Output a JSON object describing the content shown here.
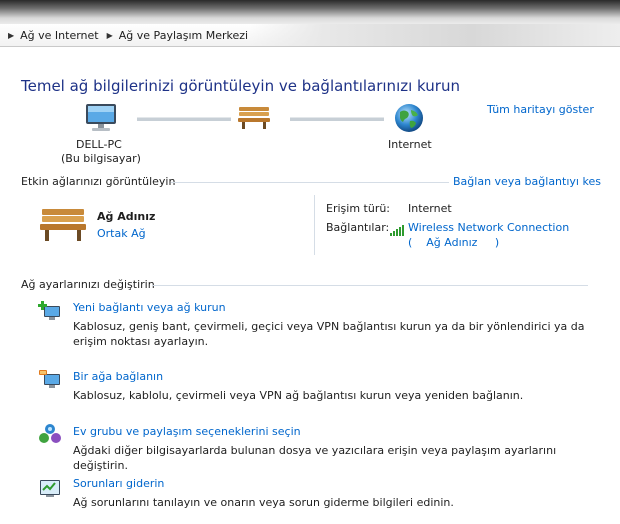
{
  "breadcrumb": {
    "items": [
      "Ağ ve Internet",
      "Ağ ve Paylaşım Merkezi"
    ]
  },
  "page_title": "Temel ağ bilgilerinizi görüntüleyin ve bağlantılarınızı kurun",
  "network_map": {
    "show_full_map_link": "Tüm haritayı göster",
    "computer_name": "DELL-PC",
    "computer_sub": "(Bu bilgisayar)",
    "internet_label": "Internet"
  },
  "active_networks": {
    "heading": "Etkin ağlarınızı görüntüleyin",
    "connect_link": "Bağlan veya bağlantıyı kes",
    "network_name": "Ağ Adınız",
    "network_type": "Ortak Ağ",
    "access_type_label": "Erişim türü:",
    "access_type_value": "Internet",
    "connections_label": "Bağlantılar:",
    "connection_name": "Wireless Network Connection",
    "connection_sub": "(    Ağ Adınız     )"
  },
  "settings": {
    "heading": "Ağ ayarlarınızı değiştirin",
    "tasks": [
      {
        "title": "Yeni bağlantı veya ağ kurun",
        "desc": "Kablosuz, geniş bant, çevirmeli, geçici veya VPN bağlantısı kurun ya da bir yönlendirici ya da erişim noktası ayarlayın."
      },
      {
        "title": "Bir ağa bağlanın",
        "desc": "Kablosuz, kablolu, çevirmeli veya VPN ağ bağlantısı kurun veya yeniden bağlanın."
      },
      {
        "title": "Ev grubu ve paylaşım seçeneklerini seçin",
        "desc": "Ağdaki diğer bilgisayarlarda bulunan dosya ve yazıcılara erişin veya paylaşım ayarlarını değiştirin."
      },
      {
        "title": "Sorunları giderin",
        "desc": "Ağ sorunlarını tanılayın ve onarın veya sorun giderme bilgileri edinin."
      }
    ]
  }
}
